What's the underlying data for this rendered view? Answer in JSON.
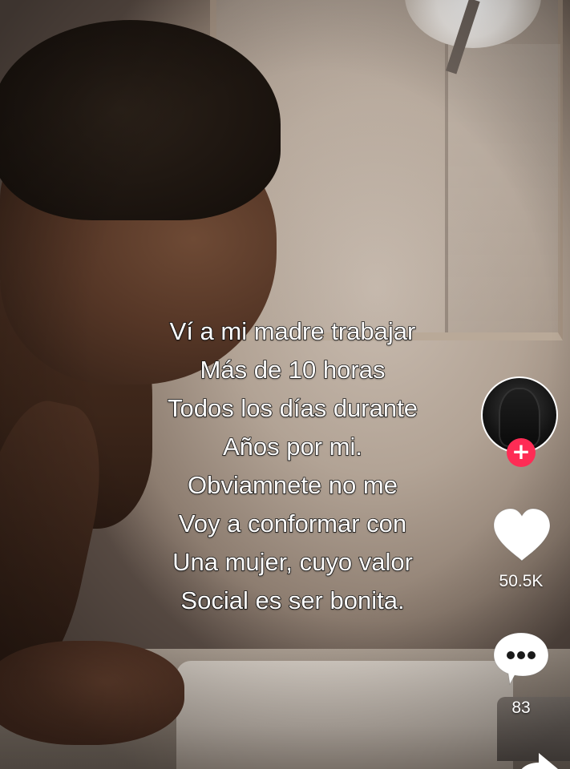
{
  "video": {
    "caption_lines": [
      "Ví a mi madre trabajar",
      "Más de 10 horas",
      "Todos los días durante",
      "Años por mi.",
      "Obviamnete no me",
      "Voy a conformar con",
      "Una mujer, cuyo valor",
      "Social es ser bonita."
    ]
  },
  "actions": {
    "follow_label": "+",
    "like_count": "50.5K",
    "comment_count": "83",
    "like_icon": "heart-icon",
    "comment_icon": "comment-bubble-icon",
    "share_icon": "share-arrow-icon"
  },
  "colors": {
    "follow_accent": "#fe2c55",
    "icon_fill": "#ffffff"
  }
}
